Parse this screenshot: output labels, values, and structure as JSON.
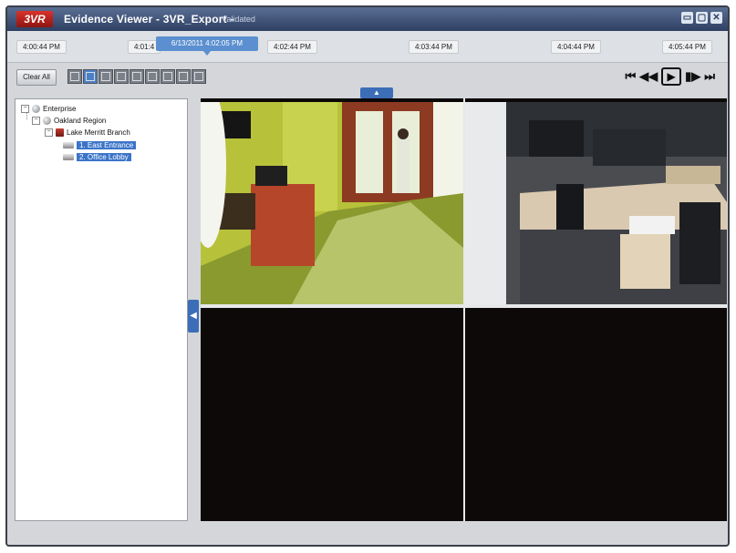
{
  "window": {
    "logo": "3VR",
    "title": "Evidence Viewer - 3VR_Export -",
    "status": "Validated",
    "buttons": [
      "▭",
      "▢",
      "✕"
    ]
  },
  "timeline": {
    "labels": [
      "4:00:44 PM",
      "4:01:4",
      "4:02:44 PM",
      "4:03:44 PM",
      "4:04:44 PM",
      "4:05:44 PM"
    ],
    "cursor": "6/13/2011 4:02:05 PM"
  },
  "toolbar": {
    "clear_all": "Clear All",
    "layout_icons": [
      "layout-1x1-icon",
      "layout-2x2-icon",
      "layout-3x3-icon",
      "layout-4x4-icon",
      "layout-5x5-icon",
      "layout-6x6-icon",
      "layout-1plus5-icon",
      "layout-1plus7-icon",
      "layout-1plus12-icon"
    ],
    "active_layout_index": 1
  },
  "playback": {
    "first": "⏮",
    "rewind": "◀◀",
    "play": "▶",
    "step": "▮▶",
    "last": "⏭"
  },
  "tree": {
    "root": "Enterprise",
    "region": "Oakland Region",
    "branch": "Lake Merritt Branch",
    "cameras": [
      "1. East Entrance",
      "2. Office Lobby"
    ]
  },
  "handles": {
    "top": "▲",
    "side": "◀"
  },
  "colors": {
    "titlebar": "#2e3f63",
    "selection": "#3b74c9",
    "video_bg": "#0c0808"
  }
}
